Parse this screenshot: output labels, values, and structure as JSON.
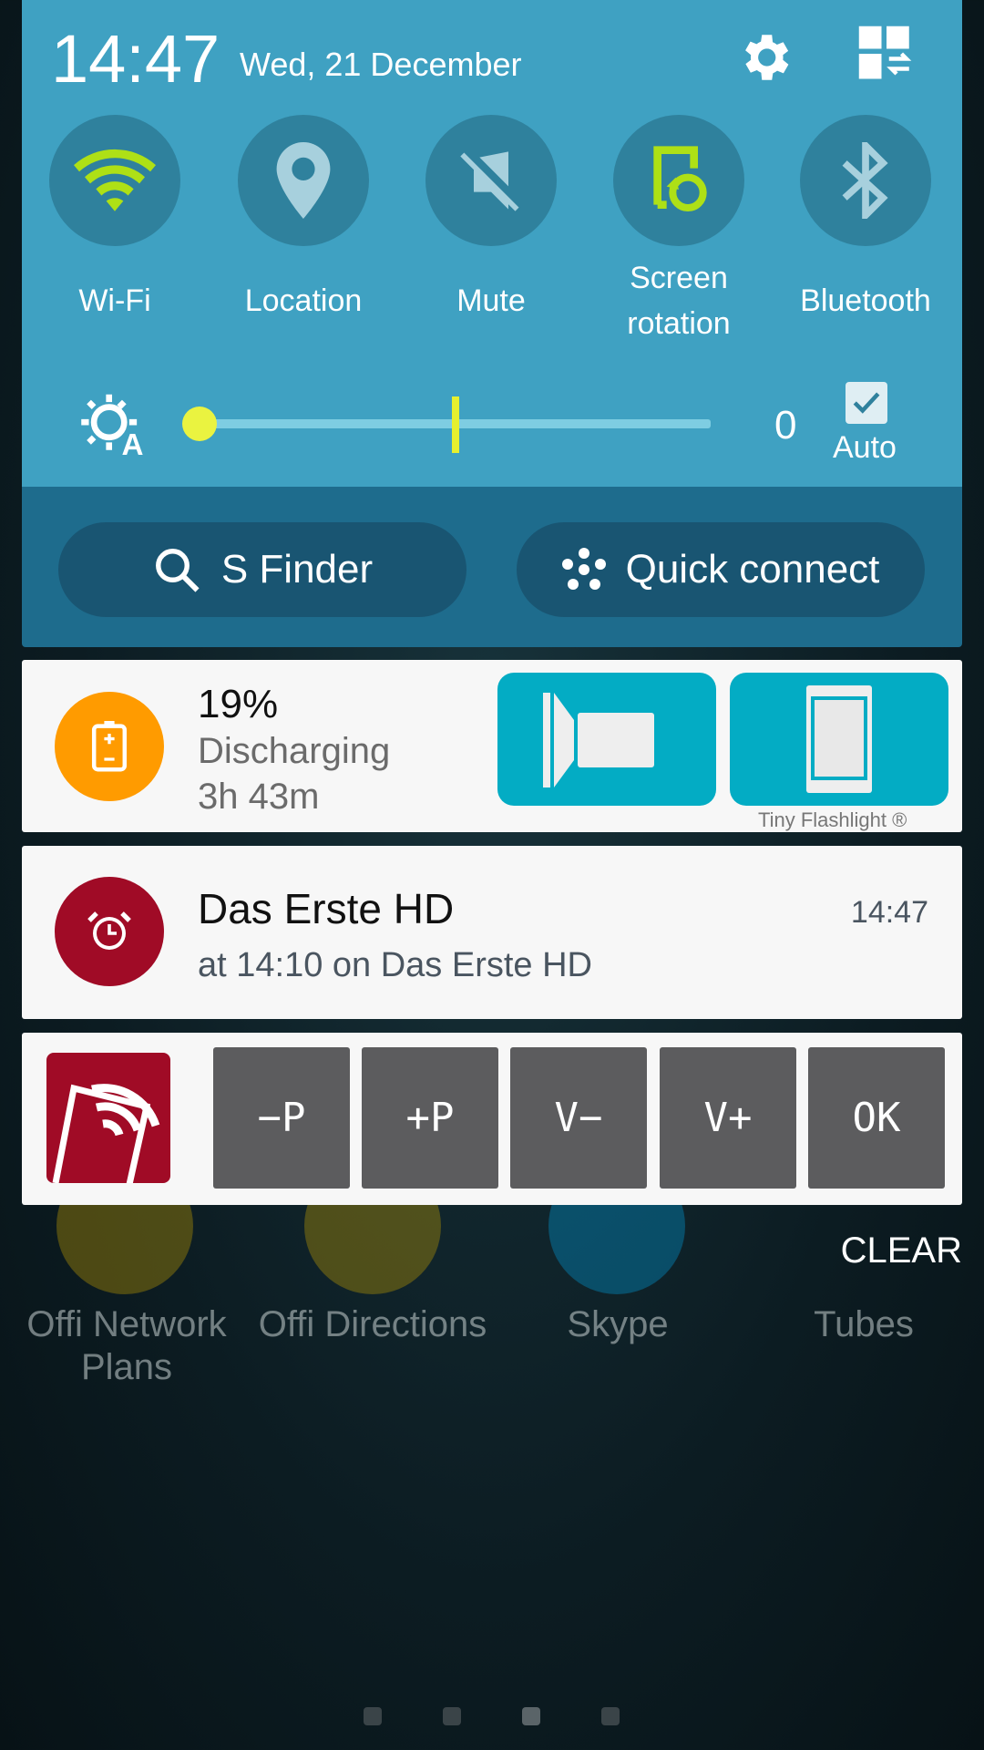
{
  "status": {
    "time": "14:47",
    "date": "Wed, 21 December"
  },
  "header_icons": [
    "gear-icon",
    "edit-toggles-icon"
  ],
  "toggles": [
    {
      "label": "Wi-Fi",
      "icon": "wifi-icon",
      "on": true
    },
    {
      "label": "Location",
      "icon": "location-pin-icon",
      "on": false
    },
    {
      "label": "Mute",
      "icon": "mute-icon",
      "on": false
    },
    {
      "label": "Screen rotation",
      "icon": "screen-rotation-icon",
      "on": true
    },
    {
      "label": "Bluetooth",
      "icon": "bluetooth-icon",
      "on": false
    }
  ],
  "brightness": {
    "value": "0",
    "level": 0,
    "auto_label": "Auto",
    "auto_checked": true
  },
  "buttons": {
    "sfinder": "S Finder",
    "quick_connect": "Quick connect"
  },
  "battery": {
    "percent": "19%",
    "status": "Discharging",
    "remaining": "3h 43m",
    "flashlight_label": "Tiny Flashlight ®"
  },
  "reminder": {
    "title": "Das Erste HD",
    "subtitle": "at 14:10 on Das Erste HD",
    "time": "14:47"
  },
  "remote": {
    "buttons": [
      "−P",
      "+P",
      "V−",
      "V+",
      "OK"
    ]
  },
  "clear_label": "CLEAR",
  "home": {
    "apps": [
      "Offi Network Plans",
      "Offi Directions",
      "Skype",
      "Tubes"
    ],
    "pages": 4,
    "current_page": 3
  },
  "colors": {
    "panel": "#3fa1c2",
    "accent": "#aee016",
    "battery": "#ff9b00",
    "alarm": "#a00b26",
    "flash": "#03acc4"
  }
}
